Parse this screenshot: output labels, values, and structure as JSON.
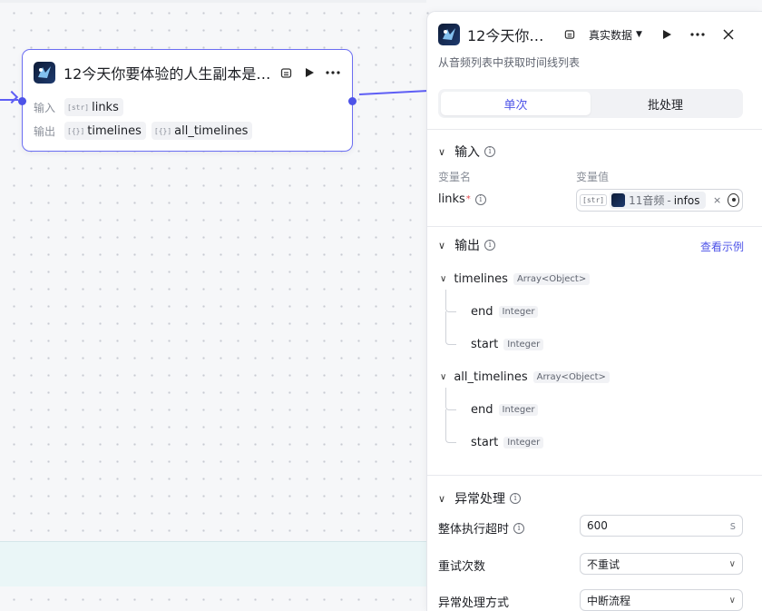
{
  "node": {
    "title": "12今天你要体验的人生副本是…",
    "inputs_label": "输入",
    "outputs_label": "输出",
    "inputs": [
      {
        "tag": "[str]",
        "name": "links"
      }
    ],
    "outputs": [
      {
        "tag": "[{}]",
        "name": "timelines"
      },
      {
        "tag": "[{}]",
        "name": "all_timelines"
      }
    ]
  },
  "panel": {
    "title": "12今天你…",
    "data_mode": "真实数据",
    "description": "从音频列表中获取时间线列表",
    "tabs": [
      {
        "label": "单次",
        "active": true
      },
      {
        "label": "批处理",
        "active": false
      }
    ],
    "input_section": {
      "title": "输入",
      "col_name": "变量名",
      "col_value": "变量值",
      "field": {
        "name": "links",
        "required_mark": "*",
        "type_tag": "[str]",
        "ref_node": "11音频",
        "ref_sep": "-",
        "ref_var": "infos",
        "clear": "×"
      }
    },
    "output_section": {
      "title": "输出",
      "example_link": "查看示例",
      "items": [
        {
          "name": "timelines",
          "type": "Array<Object>",
          "children": [
            {
              "name": "end",
              "type": "Integer"
            },
            {
              "name": "start",
              "type": "Integer"
            }
          ]
        },
        {
          "name": "all_timelines",
          "type": "Array<Object>",
          "children": [
            {
              "name": "end",
              "type": "Integer"
            },
            {
              "name": "start",
              "type": "Integer"
            }
          ]
        }
      ]
    },
    "error_section": {
      "title": "异常处理",
      "timeout_label": "整体执行超时",
      "timeout_value": "600",
      "timeout_unit": "s",
      "retry_label": "重试次数",
      "retry_value": "不重试",
      "mode_label": "异常处理方式",
      "mode_value": "中断流程"
    }
  },
  "icons": [
    "app-logo-icon",
    "debug-icon",
    "play-icon",
    "more-icon",
    "close-icon",
    "chevron-down-icon",
    "info-icon",
    "variable-picker-icon"
  ],
  "colors": {
    "accent": "#4d53e8",
    "node_border": "#6b6ef2",
    "required": "#e5484d"
  }
}
